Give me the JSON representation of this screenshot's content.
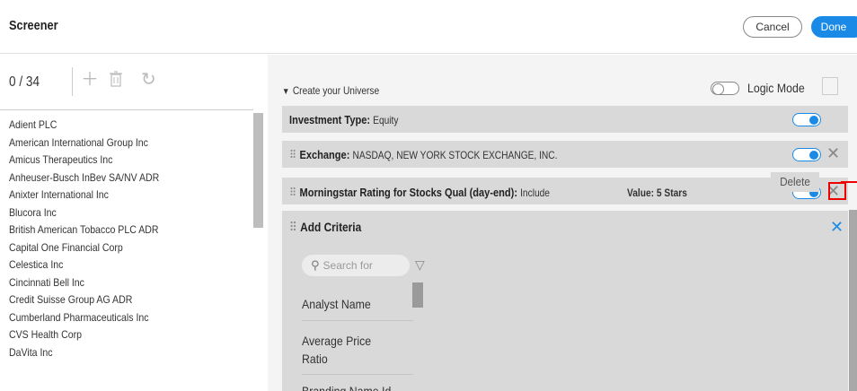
{
  "header": {
    "title": "Screener",
    "cancel_label": "Cancel",
    "done_label": "Done"
  },
  "left": {
    "count": "0 / 34",
    "companies": [
      "Adient PLC",
      "American International Group Inc",
      "Amicus Therapeutics Inc",
      "Anheuser-Busch InBev SA/NV ADR",
      "Anixter International Inc",
      "Blucora Inc",
      "British American Tobacco PLC ADR",
      "Capital One Financial Corp",
      "Celestica Inc",
      "Cincinnati Bell Inc",
      "Credit Suisse Group AG ADR",
      "Cumberland Pharmaceuticals Inc",
      "CVS Health Corp",
      "DaVita Inc"
    ]
  },
  "main": {
    "universe_label": "Create your Universe",
    "logic_mode_label": "Logic Mode",
    "rows": [
      {
        "name": "Investment Type:",
        "value": "Equity"
      },
      {
        "name": "Exchange:",
        "value": "NASDAQ, NEW YORK STOCK EXCHANGE, INC."
      },
      {
        "name": "Morningstar Rating for Stocks Qual (day-end):",
        "value": "Include",
        "extra": "Value: 5 Stars"
      }
    ],
    "tooltip": "Delete",
    "add_criteria": {
      "title": "Add Criteria",
      "search_placeholder": "Search for",
      "options": [
        "Analyst Name",
        "Average Price Ratio",
        "Branding Name Id"
      ]
    }
  },
  "colors": {
    "accent": "#1a8ae6",
    "highlight": "#e00000"
  }
}
